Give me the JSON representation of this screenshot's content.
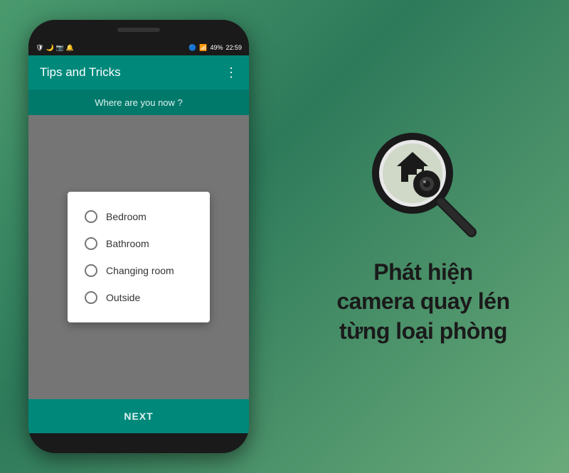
{
  "app": {
    "title": "Tips and Tricks",
    "subtitle": "Where are you now ?",
    "menu_icon": "⋮",
    "next_label": "NEXT"
  },
  "status_bar": {
    "left_icons": "🛡 🌙 📷 🔔",
    "battery": "49%",
    "time": "22:59",
    "signal": "📶"
  },
  "dialog": {
    "options": [
      {
        "id": "bedroom",
        "label": "Bedroom"
      },
      {
        "id": "bathroom",
        "label": "Bathroom"
      },
      {
        "id": "changing_room",
        "label": "Changing room"
      },
      {
        "id": "outside",
        "label": "Outside"
      }
    ]
  },
  "promo": {
    "line1": "Phát hiện",
    "line2": "camera quay lén",
    "line3": "từng loại phòng"
  },
  "icons": {
    "magnifier": "magnifier-search-icon",
    "menu": "more-vert-icon"
  }
}
